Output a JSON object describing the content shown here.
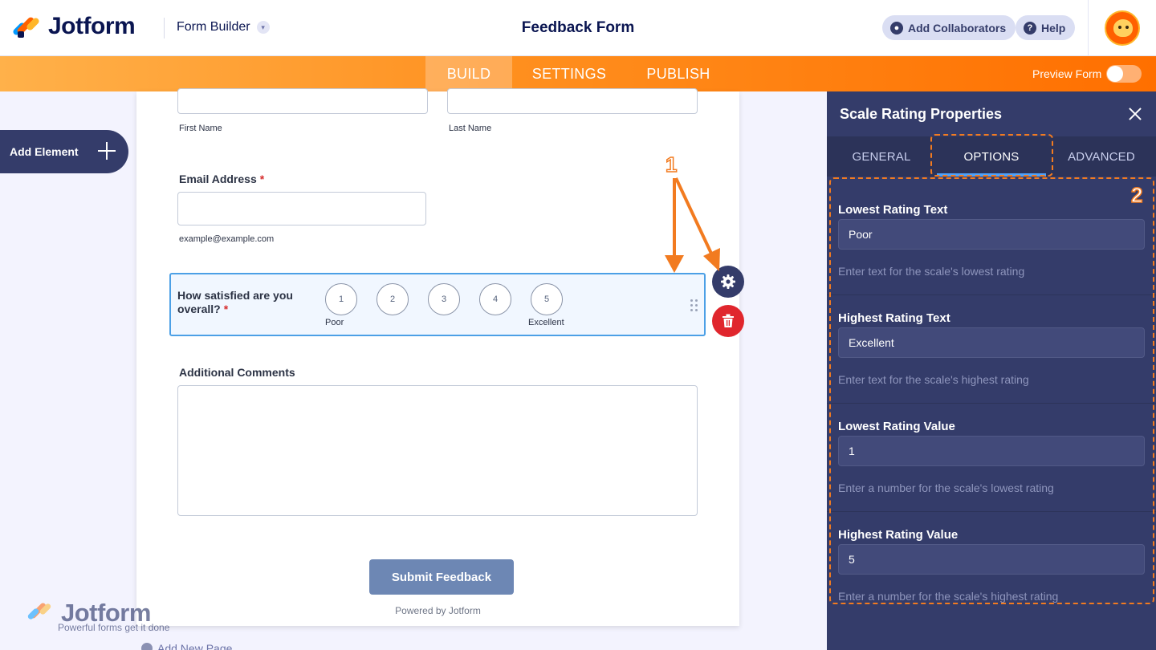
{
  "header": {
    "brand": "Jotform",
    "builder_label": "Form Builder",
    "form_title": "Feedback Form",
    "add_collaborators": "Add Collaborators",
    "help": "Help"
  },
  "nav": {
    "tabs": [
      {
        "label": "BUILD",
        "active": true
      },
      {
        "label": "SETTINGS",
        "active": false
      },
      {
        "label": "PUBLISH",
        "active": false
      }
    ],
    "preview_label": "Preview Form",
    "preview_on": false
  },
  "sidebar": {
    "add_element": "Add Element"
  },
  "form": {
    "first_name_sub": "First Name",
    "last_name_sub": "Last Name",
    "email": {
      "label": "Email Address",
      "required": "*",
      "sublabel": "example@example.com"
    },
    "scale": {
      "question": "How satisfied are you overall?",
      "required": "*",
      "options": [
        "1",
        "2",
        "3",
        "4",
        "5"
      ],
      "low_caption": "Poor",
      "high_caption": "Excellent"
    },
    "comments": {
      "label": "Additional Comments"
    },
    "submit": "Submit Feedback",
    "powered": "Powered by Jotform",
    "add_page": "Add New Page"
  },
  "watermark": {
    "brand": "Jotform",
    "tagline": "Powerful forms get it done"
  },
  "panel": {
    "title": "Scale Rating Properties",
    "tabs": [
      {
        "label": "GENERAL",
        "active": false
      },
      {
        "label": "OPTIONS",
        "active": true
      },
      {
        "label": "ADVANCED",
        "active": false
      }
    ],
    "properties": [
      {
        "label": "Lowest Rating Text",
        "value": "Poor",
        "hint": "Enter text for the scale's lowest rating"
      },
      {
        "label": "Highest Rating Text",
        "value": "Excellent",
        "hint": "Enter text for the scale's highest rating"
      },
      {
        "label": "Lowest Rating Value",
        "value": "1",
        "hint": "Enter a number for the scale's lowest rating"
      },
      {
        "label": "Highest Rating Value",
        "value": "5",
        "hint": "Enter a number for the scale's highest rating"
      }
    ]
  },
  "annotations": {
    "marker_1": "1",
    "marker_2": "2",
    "color": "#f27b20"
  },
  "colors": {
    "accent_orange": "#ff6f00",
    "panel_bg": "#343c6a",
    "selection_blue": "#4ca0e6",
    "delete_red": "#e0262d"
  },
  "icons": [
    "user-icon",
    "help-icon",
    "gear-icon",
    "trash-icon",
    "plus-icon",
    "close-icon",
    "chevron-down-icon",
    "drag-handle-icon"
  ]
}
